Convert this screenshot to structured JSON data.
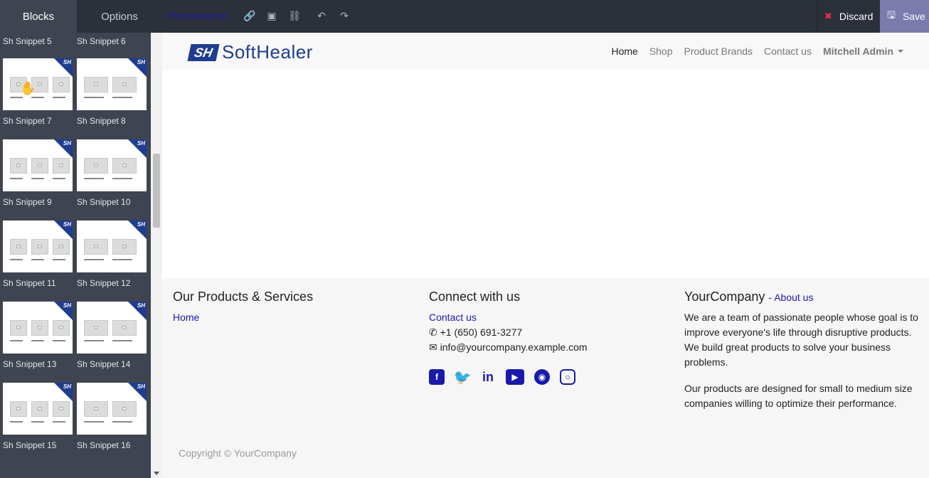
{
  "panel": {
    "tabs": [
      {
        "label": "Blocks",
        "active": true
      },
      {
        "label": "Options",
        "active": false
      }
    ],
    "corner_badge": "SH",
    "snippets": [
      "Sh Snippet 5",
      "Sh Snippet 6",
      "Sh Snippet 7",
      "Sh Snippet 8",
      "Sh Snippet 9",
      "Sh Snippet 10",
      "Sh Snippet 11",
      "Sh Snippet 12",
      "Sh Snippet 13",
      "Sh Snippet 14",
      "Sh Snippet 15",
      "Sh Snippet 16"
    ]
  },
  "editor_bar": {
    "url": "/shop/category/c",
    "discard_label": "Discard",
    "save_label": "Save"
  },
  "site": {
    "logo_mark": "SH",
    "logo_text": "SoftHealer",
    "nav": [
      "Home",
      "Shop",
      "Product Brands",
      "Contact us"
    ],
    "nav_active": "Home",
    "user": "Mitchell Admin"
  },
  "footer": {
    "col1_title": "Our Products & Services",
    "col1_link": "Home",
    "col2_title": "Connect with us",
    "col2_link": "Contact us",
    "phone": "+1 (650) 691-3277",
    "email": "info@yourcompany.example.com",
    "social_icons": [
      "facebook-icon",
      "twitter-icon",
      "linkedin-icon",
      "youtube-icon",
      "github-icon",
      "instagram-icon"
    ],
    "col3_title": "YourCompany",
    "col3_link": "About us",
    "about_p1": "We are a team of passionate people whose goal is to improve everyone's life through disruptive products. We build great products to solve your business problems.",
    "about_p2": "Our products are designed for small to medium size companies willing to optimize their performance.",
    "copyright": "Copyright © YourCompany"
  },
  "colors": {
    "panel_bg": "#3e4450",
    "topbar_bg": "#2b303a",
    "save_bg": "#7c7bad",
    "brand_blue": "#1f3d8f",
    "link_blue": "#1a1aaa"
  }
}
